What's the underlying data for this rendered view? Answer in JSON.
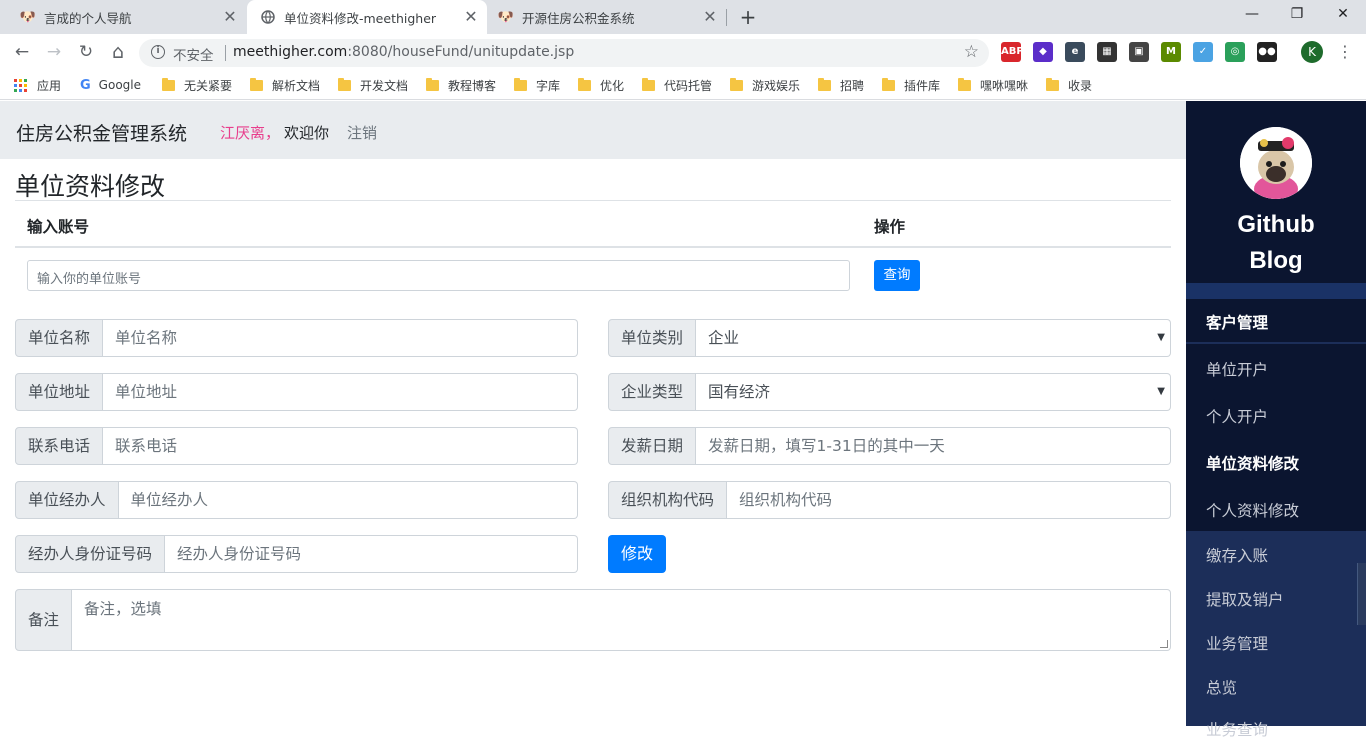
{
  "browser": {
    "tabs": [
      {
        "title": "言成的个人导航",
        "active": false
      },
      {
        "title": "单位资料修改-meethigher",
        "active": true
      },
      {
        "title": "开源住房公积金系统",
        "active": false
      }
    ],
    "close_glyph": "✕",
    "newtab_glyph": "+",
    "window_controls": {
      "minimize": "—",
      "restore": "❐",
      "close": "✕"
    },
    "nav": {
      "back": "←",
      "forward": "→",
      "reload": "↻",
      "home": "⌂"
    },
    "security_label": "不安全",
    "url_host": "meethigher.com",
    "url_rest": ":8080/houseFund/unitupdate.jsp",
    "profile_initial": "K",
    "extensions": [
      {
        "name": "abp-icon",
        "label": "ABP",
        "color": "#d9262c"
      },
      {
        "name": "ext-diamond-icon",
        "label": "◆",
        "color": "#5b2dc9"
      },
      {
        "name": "ext-e-icon",
        "label": "e",
        "color": "#3a4b5c"
      },
      {
        "name": "qr-code-icon",
        "label": "▦",
        "color": "#333333"
      },
      {
        "name": "pip-icon",
        "label": "▣",
        "color": "#444444"
      },
      {
        "name": "ext-m-icon",
        "label": "M",
        "color": "#5b8a00"
      },
      {
        "name": "ext-check-icon",
        "label": "✓",
        "color": "#4ba3e3"
      },
      {
        "name": "ext-compass-icon",
        "label": "◎",
        "color": "#2aa05a"
      },
      {
        "name": "ext-glasses-icon",
        "label": "●●",
        "color": "#222222"
      }
    ],
    "bookmarks": [
      {
        "label": "应用",
        "kind": "apps"
      },
      {
        "label": "Google",
        "kind": "google"
      },
      {
        "label": "无关紧要",
        "kind": "folder"
      },
      {
        "label": "解析文档",
        "kind": "folder"
      },
      {
        "label": "开发文档",
        "kind": "folder"
      },
      {
        "label": "教程博客",
        "kind": "folder"
      },
      {
        "label": "字库",
        "kind": "folder"
      },
      {
        "label": "优化",
        "kind": "folder"
      },
      {
        "label": "代码托管",
        "kind": "folder"
      },
      {
        "label": "游戏娱乐",
        "kind": "folder"
      },
      {
        "label": "招聘",
        "kind": "folder"
      },
      {
        "label": "插件库",
        "kind": "folder"
      },
      {
        "label": "嘿咻嘿咻",
        "kind": "folder"
      },
      {
        "label": "收录",
        "kind": "folder"
      }
    ]
  },
  "header": {
    "brand": "住房公积金管理系统",
    "user": "江厌离，",
    "welcome": "欢迎你",
    "logout": "注销"
  },
  "main": {
    "title": "单位资料修改",
    "table": {
      "col_account": "输入账号",
      "col_action": "操作",
      "account_placeholder": "输入你的单位账号",
      "query_button": "查询"
    },
    "form": {
      "unit_name": {
        "label": "单位名称",
        "placeholder": "单位名称"
      },
      "unit_category": {
        "label": "单位类别",
        "value": "企业"
      },
      "unit_address": {
        "label": "单位地址",
        "placeholder": "单位地址"
      },
      "enterprise_type": {
        "label": "企业类型",
        "value": "国有经济"
      },
      "phone": {
        "label": "联系电话",
        "placeholder": "联系电话"
      },
      "pay_date": {
        "label": "发薪日期",
        "placeholder": "发薪日期，填写1-31日的其中一天"
      },
      "agent": {
        "label": "单位经办人",
        "placeholder": "单位经办人"
      },
      "org_code": {
        "label": "组织机构代码",
        "placeholder": "组织机构代码"
      },
      "agent_id": {
        "label": "经办人身份证号码",
        "placeholder": "经办人身份证号码"
      },
      "modify_button": "修改",
      "remark": {
        "label": "备注",
        "placeholder": "备注，选填"
      }
    }
  },
  "sidebar": {
    "title_line1": "Github",
    "title_line2": "Blog",
    "group_head": "客户管理",
    "items": [
      "单位开户",
      "个人开户",
      "单位资料修改",
      "个人资料修改"
    ],
    "active_item": "单位资料修改",
    "lower_items": [
      "缴存入账",
      "提取及销户",
      "业务管理",
      "总览",
      "业务查询"
    ]
  },
  "colors": {
    "primary": "#007bff",
    "sidebar_bg": "#1c2e59",
    "sidebar_dark": "#0b1530",
    "user_pink": "#e83e8c"
  }
}
